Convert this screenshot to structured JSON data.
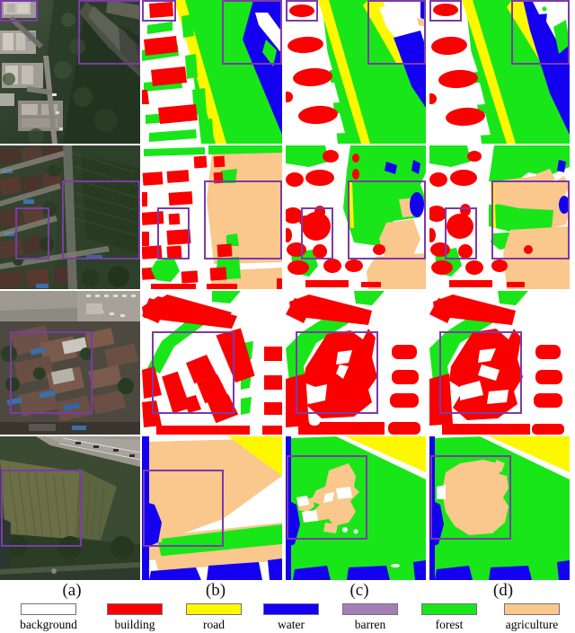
{
  "figure": {
    "type": "semantic-segmentation-comparison-grid",
    "rows": 4,
    "columns": 4
  },
  "column_labels": [
    {
      "key": "a",
      "label": "(a)",
      "meaning": "image"
    },
    {
      "key": "b",
      "label": "(b)",
      "meaning": "ground truth"
    },
    {
      "key": "c",
      "label": "(c)",
      "meaning": "prediction c"
    },
    {
      "key": "d",
      "label": "(d)",
      "meaning": "prediction d"
    }
  ],
  "legend": {
    "items": [
      {
        "label": "background",
        "color": "#ffffff"
      },
      {
        "label": "building",
        "color": "#fa0000"
      },
      {
        "label": "road",
        "color": "#fdf800"
      },
      {
        "label": "water",
        "color": "#1400f0"
      },
      {
        "label": "barren",
        "color": "#a37fb5"
      },
      {
        "label": "forest",
        "color": "#19e619"
      },
      {
        "label": "agriculture",
        "color": "#fac78c"
      }
    ],
    "swatch_border_color": "#6f6f8a"
  },
  "annotation": {
    "roi_box_color": "#7b3ba8",
    "roi_box_width": 2
  },
  "rows": [
    {
      "id": "row-1",
      "scene": "riverbank with buildings and vegetation",
      "classes_present": [
        "background",
        "building",
        "road",
        "water",
        "forest"
      ],
      "roi_boxes": 2
    },
    {
      "id": "row-2",
      "scene": "dense village houses beside farmland",
      "classes_present": [
        "background",
        "building",
        "forest",
        "agriculture",
        "water",
        "road"
      ],
      "roi_boxes": 2
    },
    {
      "id": "row-3",
      "scene": "urban residential block with rooftops",
      "classes_present": [
        "background",
        "building",
        "forest"
      ],
      "roi_boxes": 1
    },
    {
      "id": "row-4",
      "scene": "orchard field next to highway and river",
      "classes_present": [
        "background",
        "road",
        "water",
        "forest",
        "agriculture"
      ],
      "roi_boxes": 1
    }
  ]
}
